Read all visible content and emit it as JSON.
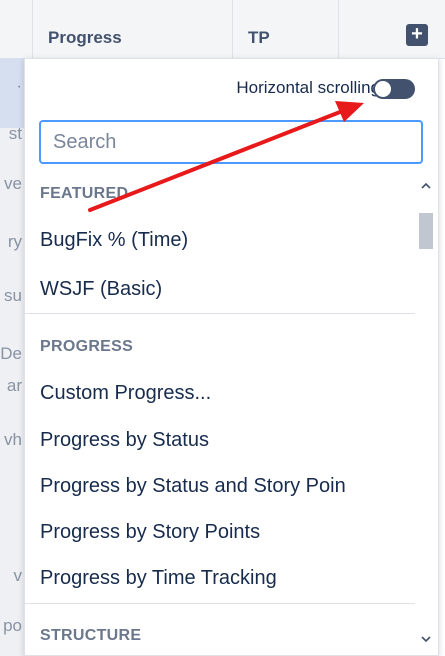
{
  "header": {
    "columns": [
      "Progress",
      "TP"
    ],
    "add_icon": "plus-square-icon"
  },
  "left_column_fragments": [
    "·",
    "st",
    "ve",
    "ry",
    "su",
    "De",
    "ar",
    "vh",
    "v",
    "po"
  ],
  "panel": {
    "horizontal_scrolling": {
      "label": "Horizontal scrolling",
      "enabled": false
    },
    "search": {
      "placeholder": "Search",
      "value": ""
    },
    "sections": [
      {
        "heading": "FEATURED",
        "items": [
          "BugFix % (Time)",
          "WSJF (Basic)"
        ]
      },
      {
        "heading": "PROGRESS",
        "items": [
          "Custom Progress...",
          "Progress by Status",
          "Progress by Status and Story Poin",
          "Progress by Story Points",
          "Progress by Time Tracking"
        ]
      },
      {
        "heading": "STRUCTURE",
        "items": []
      }
    ],
    "scroll_position": 0.05
  },
  "annotation": {
    "type": "red-arrow",
    "color": "#e8191b",
    "points_to": "horizontal-scrolling-toggle"
  }
}
